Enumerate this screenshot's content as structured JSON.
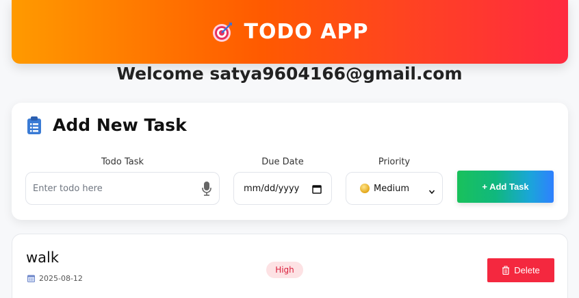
{
  "header": {
    "title": "TODO APP",
    "icon": "target-dart-icon"
  },
  "welcome": "Welcome satya9604166@gmail.com",
  "add_task_card": {
    "title": "Add New Task",
    "icon": "clipboard-icon",
    "fields": {
      "task": {
        "label": "Todo Task",
        "placeholder": "Enter todo here",
        "icon": "microphone-icon"
      },
      "due_date": {
        "label": "Due Date",
        "placeholder": "mm/dd/yyyy",
        "icon": "calendar-icon"
      },
      "priority": {
        "label": "Priority",
        "selected": "Medium",
        "icon": "medium-dot-icon"
      }
    },
    "add_button": "+ Add Task"
  },
  "tasks": [
    {
      "name": "walk",
      "date": "2025-08-12",
      "priority": "High",
      "delete_label": "Delete"
    }
  ],
  "colors": {
    "header_gradient": [
      "#ff9a00",
      "#ff2a40"
    ],
    "add_button_gradient": [
      "#19c15b",
      "#2f80ff"
    ],
    "delete_button": "#f4283f",
    "priority_high_bg": "#fde2e4",
    "priority_high_text": "#d91f3b"
  }
}
